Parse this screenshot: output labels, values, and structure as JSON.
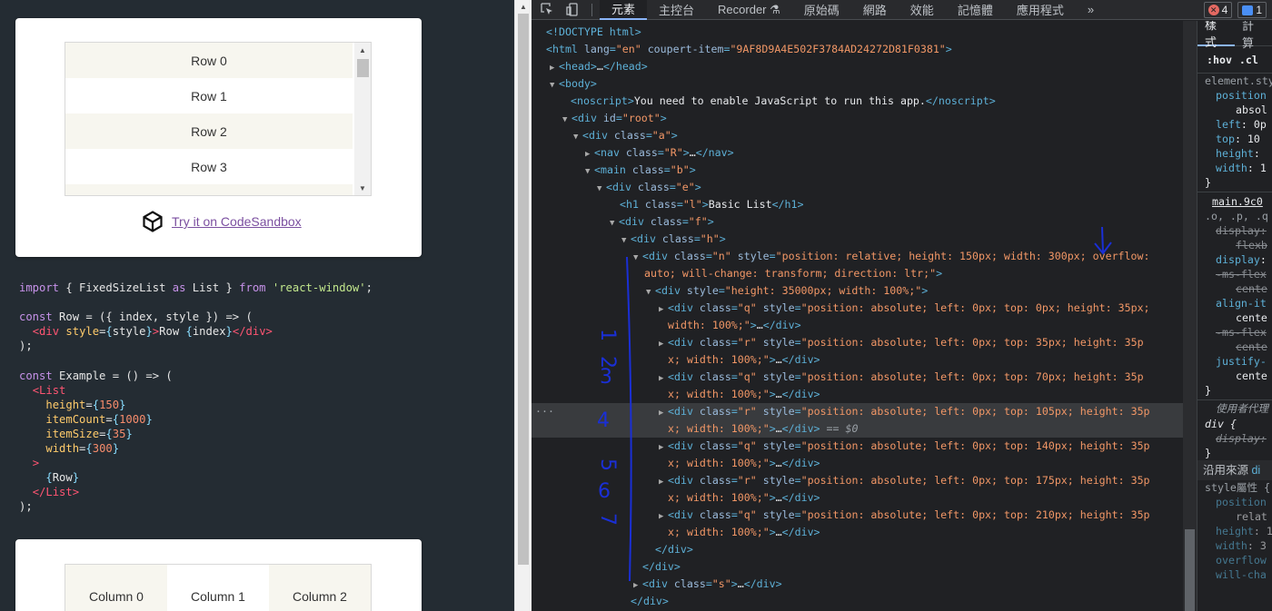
{
  "left": {
    "row_list": [
      "Row 0",
      "Row 1",
      "Row 2",
      "Row 3"
    ],
    "codesandbox_link": "Try it on CodeSandbox",
    "column_list": [
      "Column 0",
      "Column 1",
      "Column 2"
    ]
  },
  "devtools": {
    "tabs": [
      "元素",
      "主控台",
      "Recorder ⚗",
      "原始碼",
      "網路",
      "效能",
      "記憶體",
      "應用程式",
      "»"
    ],
    "error_count": "4",
    "message_count": "1",
    "dom_selected_suffix": "== $0",
    "styles_tabs": [
      "樣式",
      "計算"
    ],
    "styles_filter": [
      ":hov",
      ".cl"
    ]
  },
  "annotations": {
    "arrow_note": "↓",
    "vertical_numbers": [
      "1",
      "2",
      "3",
      "4",
      "5",
      "6",
      "7"
    ]
  },
  "colors": {
    "page_bg": "#242c33",
    "devtools_bg": "#202124",
    "annotation_ink": "#1a2fd6",
    "link": "#7b4fa0"
  }
}
